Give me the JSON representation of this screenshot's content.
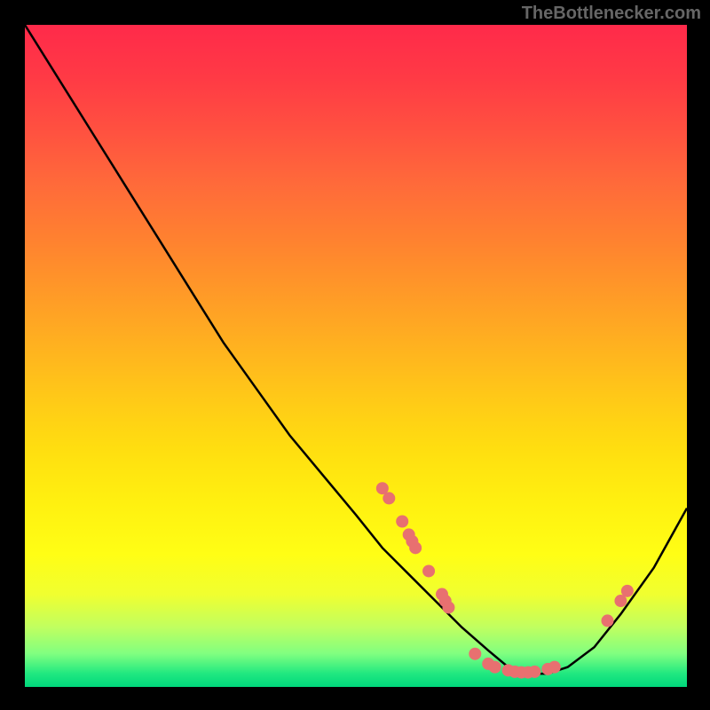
{
  "attribution": "TheBottlenecker.com",
  "chart_data": {
    "type": "line",
    "title": "",
    "xlabel": "",
    "ylabel": "",
    "xlim": [
      0,
      100
    ],
    "ylim": [
      0,
      100
    ],
    "series": [
      {
        "name": "curve",
        "x": [
          0,
          5,
          10,
          15,
          20,
          25,
          30,
          35,
          40,
          45,
          50,
          54,
          58,
          62,
          66,
          70,
          73,
          76,
          79,
          82,
          86,
          90,
          95,
          100
        ],
        "y": [
          100,
          92,
          84,
          76,
          68,
          60,
          52,
          45,
          38,
          32,
          26,
          21,
          17,
          13,
          9,
          5.5,
          3,
          2,
          2,
          3,
          6,
          11,
          18,
          27
        ]
      }
    ],
    "scatter_points": [
      {
        "x": 54,
        "y": 30
      },
      {
        "x": 55,
        "y": 28.5
      },
      {
        "x": 57,
        "y": 25
      },
      {
        "x": 58,
        "y": 23
      },
      {
        "x": 58.5,
        "y": 22
      },
      {
        "x": 59,
        "y": 21
      },
      {
        "x": 61,
        "y": 17.5
      },
      {
        "x": 63,
        "y": 14
      },
      {
        "x": 63.5,
        "y": 13
      },
      {
        "x": 64,
        "y": 12
      },
      {
        "x": 68,
        "y": 5
      },
      {
        "x": 70,
        "y": 3.5
      },
      {
        "x": 71,
        "y": 3
      },
      {
        "x": 73,
        "y": 2.5
      },
      {
        "x": 74,
        "y": 2.3
      },
      {
        "x": 75,
        "y": 2.2
      },
      {
        "x": 76,
        "y": 2.2
      },
      {
        "x": 77,
        "y": 2.3
      },
      {
        "x": 79,
        "y": 2.7
      },
      {
        "x": 80,
        "y": 3
      },
      {
        "x": 88,
        "y": 10
      },
      {
        "x": 90,
        "y": 13
      },
      {
        "x": 91,
        "y": 14.5
      }
    ]
  }
}
